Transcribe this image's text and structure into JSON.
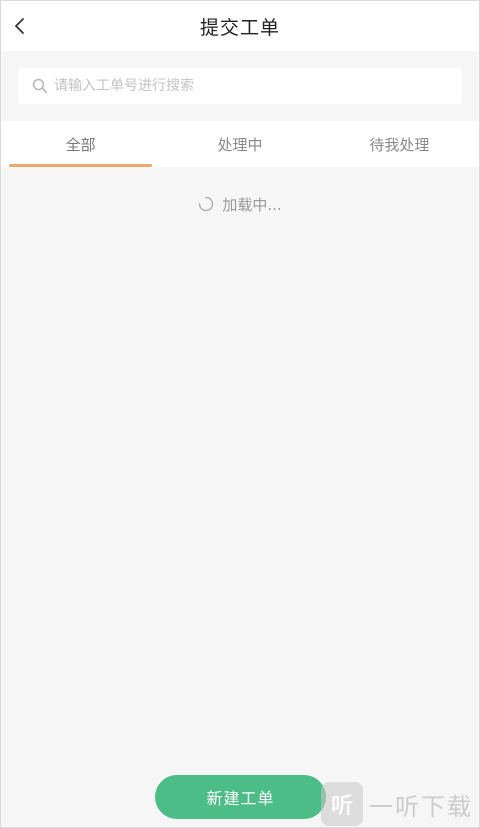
{
  "header": {
    "title": "提交工单",
    "back_icon": "chevron-left-icon"
  },
  "search": {
    "placeholder": "请输入工单号进行搜索",
    "value": "",
    "icon": "search-icon"
  },
  "tabs": [
    {
      "label": "全部",
      "active": true
    },
    {
      "label": "处理中",
      "active": false
    },
    {
      "label": "待我处理",
      "active": false
    }
  ],
  "status": {
    "loading_text": "加载中..."
  },
  "footer": {
    "new_button_label": "新建工单"
  },
  "watermark": {
    "logo_glyph": "听",
    "text": "一听下载"
  },
  "colors": {
    "accent_underline": "#e9a96a",
    "primary_button": "#4cbd86"
  }
}
